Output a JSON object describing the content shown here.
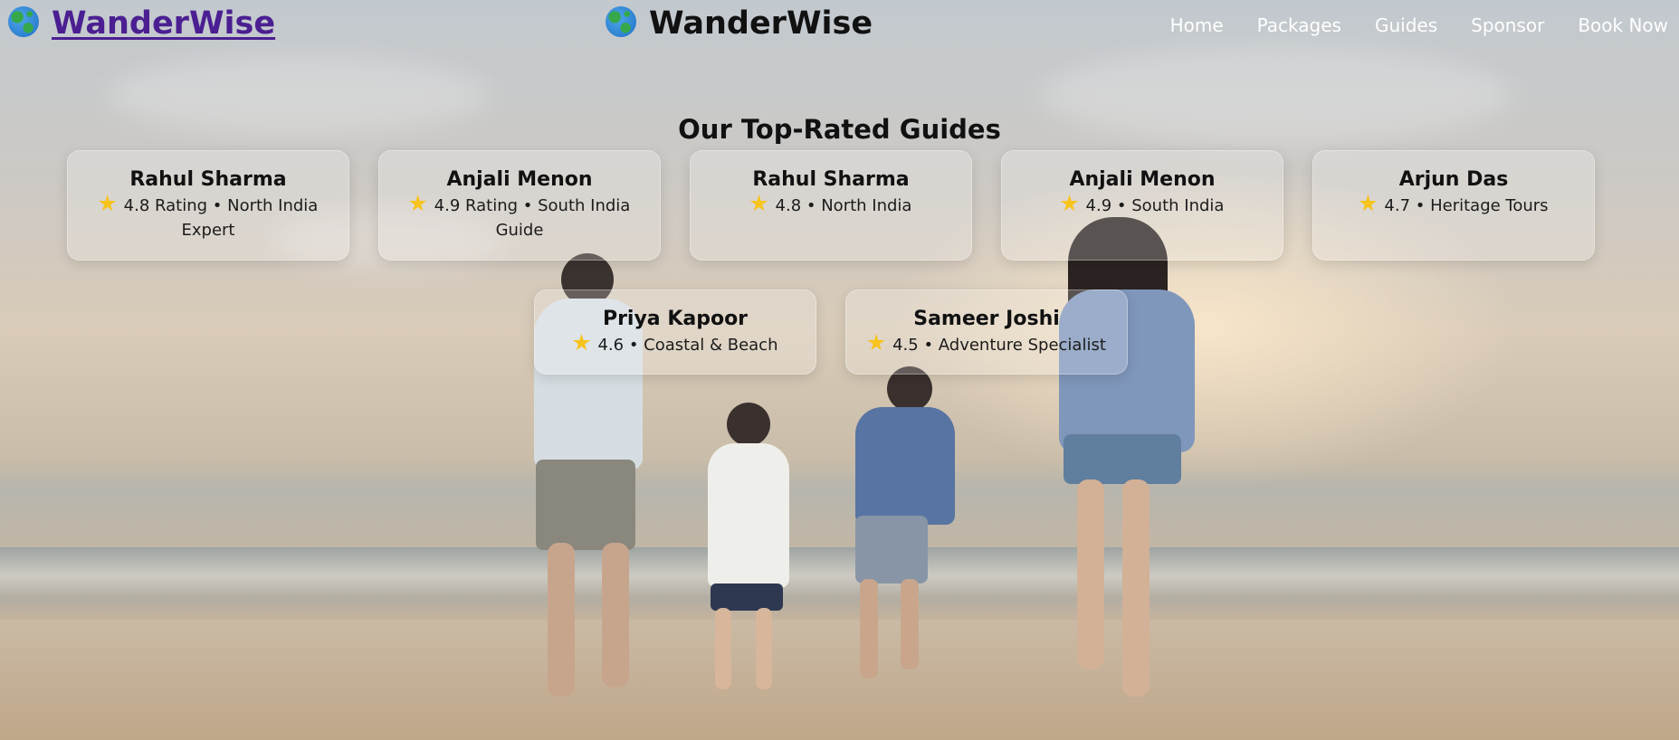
{
  "brand": {
    "logo_text": "WanderWise",
    "center_text": "WanderWise",
    "globe_icon": "globe-icon"
  },
  "nav": [
    {
      "label": "Home"
    },
    {
      "label": "Packages"
    },
    {
      "label": "Guides"
    },
    {
      "label": "Sponsor"
    },
    {
      "label": "Book Now"
    }
  ],
  "guides_section": {
    "title": "Our Top-Rated Guides",
    "star_icon": "star-icon",
    "star_color": "#f7c31d",
    "guides": [
      {
        "name": "Rahul Sharma",
        "meta": "4.8 Rating • North India Expert"
      },
      {
        "name": "Anjali Menon",
        "meta": "4.9 Rating • South India Guide"
      },
      {
        "name": "Rahul Sharma",
        "meta": "4.8 • North India"
      },
      {
        "name": "Anjali Menon",
        "meta": "4.9 • South India"
      },
      {
        "name": "Arjun Das",
        "meta": "4.7 • Heritage Tours"
      },
      {
        "name": "Priya Kapoor",
        "meta": "4.6 • Coastal & Beach"
      },
      {
        "name": "Sameer Joshi",
        "meta": "4.5 • Adventure Specialist"
      }
    ]
  },
  "colors": {
    "logo_link": "#4b1f92",
    "nav_text": "#ffffff",
    "heading": "#111111"
  }
}
